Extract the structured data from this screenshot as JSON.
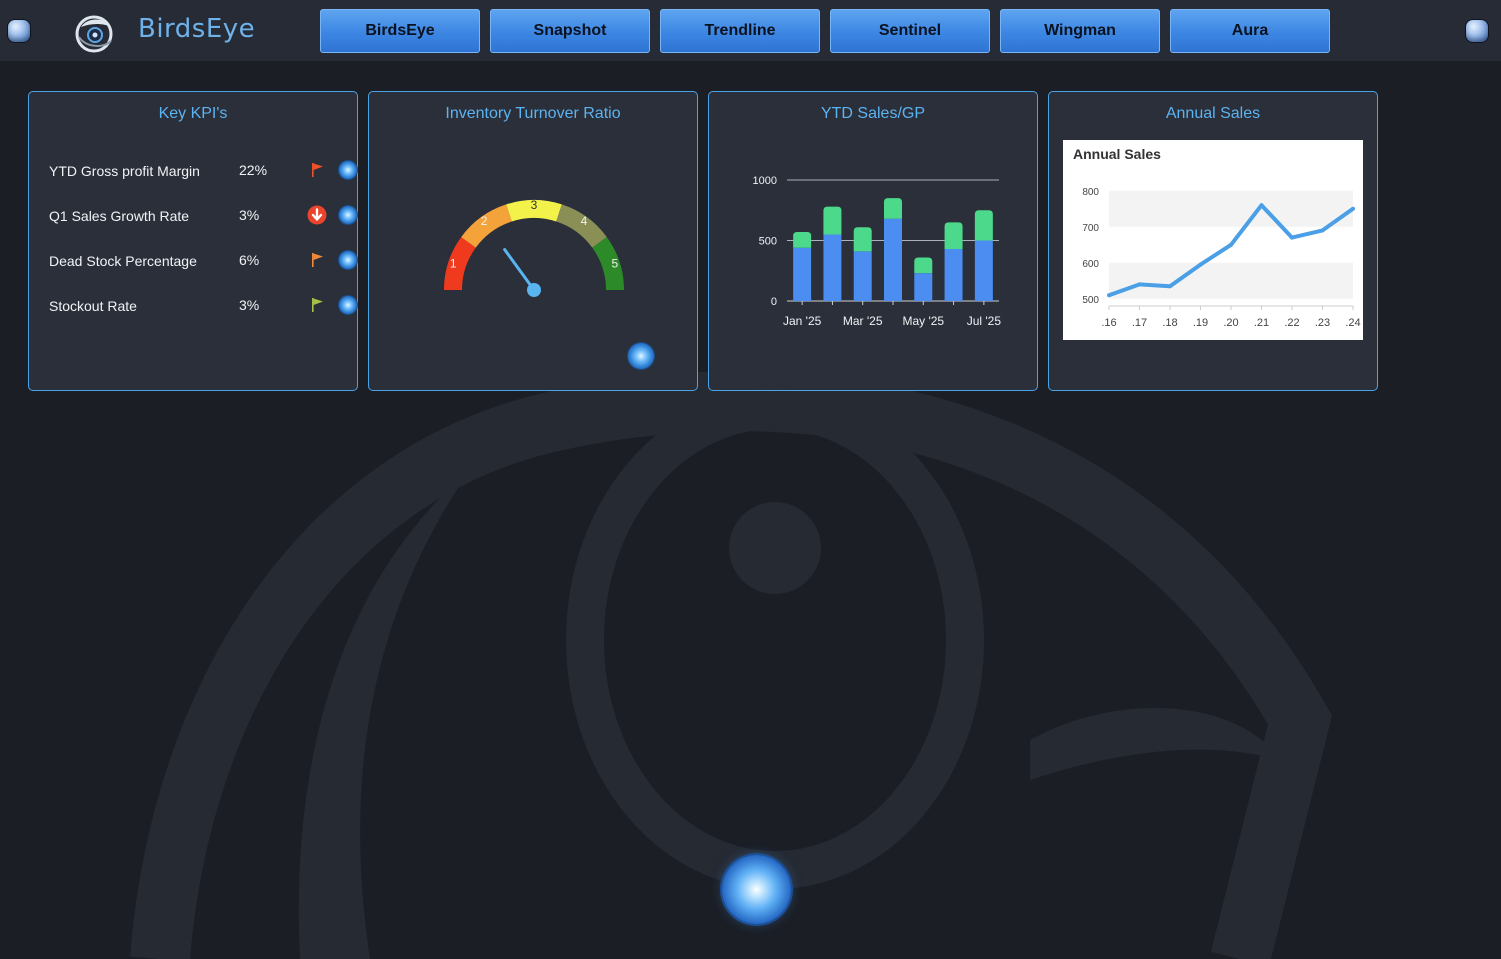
{
  "app": {
    "brand": "BirdsEye",
    "nav": [
      "BirdsEye",
      "Snapshot",
      "Trendline",
      "Sentinel",
      "Wingman",
      "Aura"
    ]
  },
  "colors": {
    "accent": "#4aa3e6",
    "card_bg": "#2a2f39",
    "page_bg": "#1b1e25",
    "bar_sales": "#4b8df0",
    "bar_gp": "#4cd98b",
    "line": "#4a9fe6"
  },
  "kpi_card": {
    "title": "Key KPI's",
    "items": [
      {
        "label": "YTD Gross profit Margin",
        "value": "22%",
        "status_icon": "red-flag-icon",
        "status_color": "#f0502a"
      },
      {
        "label": "Q1 Sales Growth Rate",
        "value": "3%",
        "status_icon": "down-arrow-icon",
        "status_color": "#e8452c"
      },
      {
        "label": "Dead Stock Percentage",
        "value": "6%",
        "status_icon": "orange-flag-icon",
        "status_color": "#f08a3a"
      },
      {
        "label": "Stockout Rate",
        "value": "3%",
        "status_icon": "green-flag-icon",
        "status_color": "#a8c04a"
      }
    ]
  },
  "gauge_card": {
    "title": "Inventory Turnover Ratio",
    "ticks": [
      "1",
      "2",
      "3",
      "4",
      "5"
    ],
    "segment_colors": [
      "#f03a1e",
      "#f4a23a",
      "#f2f24a",
      "#8a8f55",
      "#2c8a28"
    ],
    "needle_value": 2.2,
    "min": 1,
    "max": 5
  },
  "ytd_card": {
    "title": "YTD Sales/GP"
  },
  "annual_card": {
    "title": "Annual Sales"
  },
  "chart_data": [
    {
      "type": "bar",
      "stacked": true,
      "x_tick_labels": [
        "Jan '25",
        "Mar '25",
        "May '25",
        "Jul '25"
      ],
      "categories": [
        "Jan '25",
        "Feb '25",
        "Mar '25",
        "Apr '25",
        "May '25",
        "Jun '25",
        "Jul '25"
      ],
      "series": [
        {
          "values": [
            440,
            550,
            410,
            680,
            230,
            430,
            500
          ]
        },
        {
          "values": [
            130,
            230,
            200,
            170,
            130,
            220,
            250
          ]
        }
      ],
      "ylim": [
        0,
        1000
      ],
      "yticks": [
        0,
        500,
        1000
      ],
      "grid": true
    },
    {
      "type": "line",
      "title": "Annual Sales",
      "x": [
        ".16",
        ".17",
        ".18",
        ".19",
        ".20",
        ".21",
        ".22",
        ".23",
        ".24"
      ],
      "y": [
        510,
        540,
        535,
        595,
        650,
        760,
        670,
        690,
        750
      ],
      "ylim": [
        480,
        830
      ],
      "yticks": [
        500,
        600,
        700,
        800
      ],
      "grid": true
    }
  ]
}
